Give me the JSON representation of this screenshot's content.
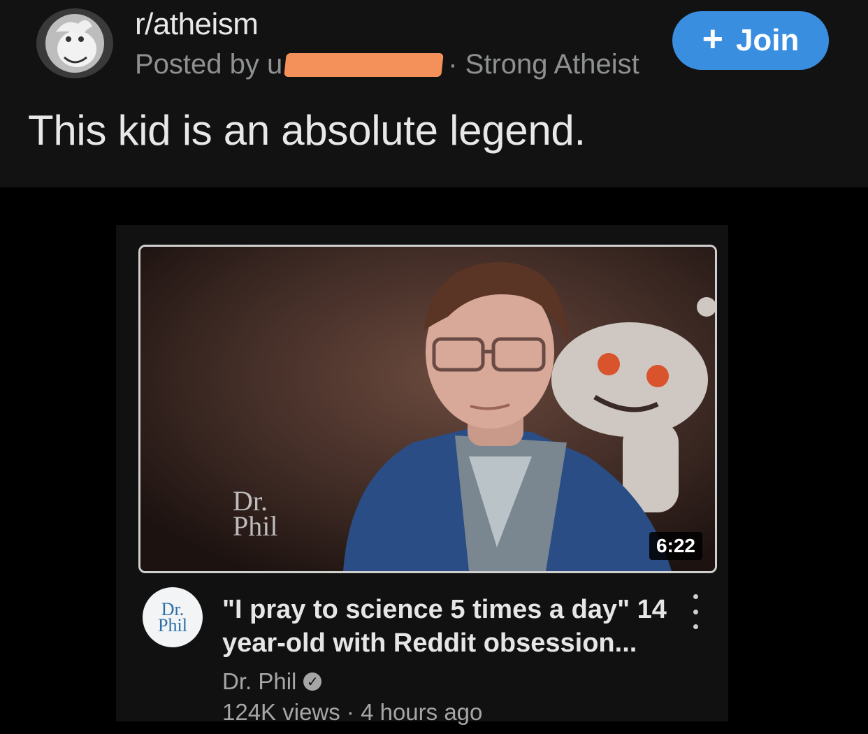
{
  "post": {
    "subreddit": "r/atheism",
    "posted_by_prefix": "Posted by u",
    "flair": "· Strong Atheist",
    "join_plus": "+",
    "join_label": "Join",
    "title": "This kid is an absolute legend."
  },
  "video": {
    "watermark": "Dr.\nPhil",
    "duration": "6:22",
    "channel_avatar_text": "Dr.\nPhil",
    "title": "\"I pray to science 5 times a day\" 14 year-old with Reddit obsession...",
    "channel": "Dr. Phil",
    "meta": "124K views · 4 hours ago"
  },
  "icons": {
    "subreddit_avatar": "subreddit-avatar-icon",
    "verified": "verified-check-icon",
    "more": "more-vertical-icon"
  },
  "colors": {
    "join_button": "#3a8ee0",
    "redaction": "#f4915a",
    "header_bg": "#121212"
  }
}
